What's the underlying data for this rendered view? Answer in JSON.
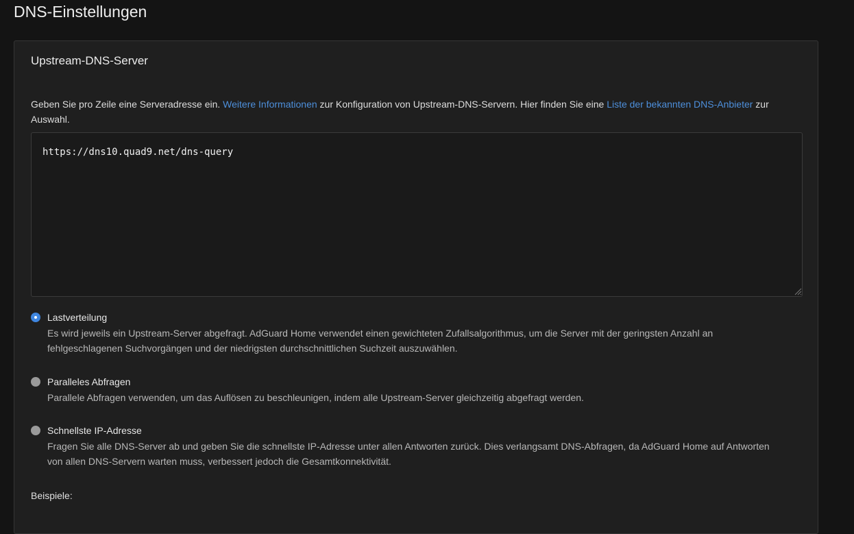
{
  "page": {
    "title": "DNS-Einstellungen"
  },
  "upstream": {
    "title": "Upstream-DNS-Server",
    "description": {
      "part1": "Geben Sie pro Zeile eine Serveradresse ein. ",
      "link1": "Weitere Informationen",
      "part2": " zur Konfiguration von Upstream-DNS-Servern. Hier finden Sie eine ",
      "link2": "Liste der bekannten DNS-Anbieter",
      "part3": " zur Auswahl."
    },
    "textarea_value": "https://dns10.quad9.net/dns-query",
    "options": [
      {
        "label": "Lastverteilung",
        "description": "Es wird jeweils ein Upstream-Server abgefragt. AdGuard Home verwendet einen gewichteten Zufallsalgorithmus, um die Server mit der geringsten Anzahl an fehlgeschlagenen Suchvorgängen und der niedrigsten durchschnittlichen Suchzeit auszuwählen.",
        "checked": true
      },
      {
        "label": "Paralleles Abfragen",
        "description": "Parallele Abfragen verwenden, um das Auflösen zu beschleunigen, indem alle Upstream-Server gleichzeitig abgefragt werden.",
        "checked": false
      },
      {
        "label": "Schnellste IP-Adresse",
        "description": "Fragen Sie alle DNS-Server ab und geben Sie die schnellste IP-Adresse unter allen Antworten zurück. Dies verlangsamt DNS-Abfragen, da AdGuard Home auf Antworten von allen DNS-Servern warten muss, verbessert jedoch die Gesamtkonnektivität.",
        "checked": false
      }
    ],
    "examples_label": "Beispiele:"
  },
  "colors": {
    "background": "#141414",
    "card": "#1f1f1f",
    "link": "#4d8fdb",
    "radio_checked": "#3f86e0",
    "radio_unchecked": "#9a9a9a"
  }
}
